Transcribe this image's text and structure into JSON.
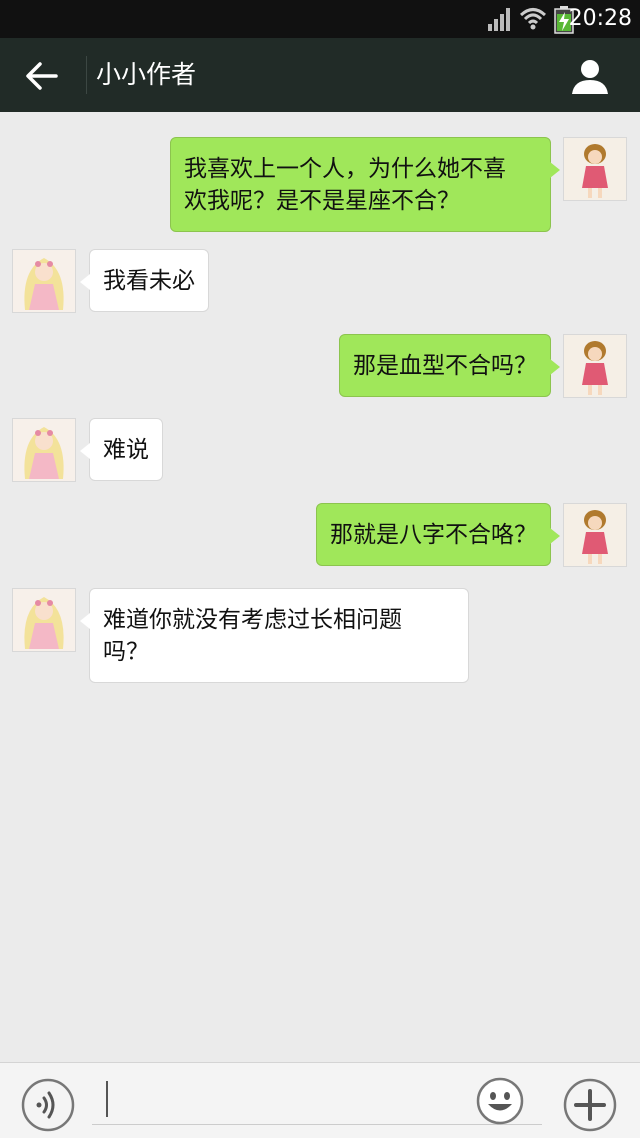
{
  "status_bar": {
    "time": "20:28",
    "icons": [
      "signal-icon",
      "wifi-icon",
      "battery-charging-icon"
    ]
  },
  "header": {
    "title": "小小作者",
    "back_icon": "arrow-left-icon",
    "profile_icon": "person-icon"
  },
  "messages": [
    {
      "sender": "me",
      "text": "我喜欢上一个人，为什么她不喜欢我呢？是不是星座不合？",
      "lines": [
        "我喜欢上一个人，为什么她不喜",
        "欢我呢？是不是星座不合？"
      ]
    },
    {
      "sender": "other",
      "text": "我看未必",
      "lines": [
        "我看未必"
      ]
    },
    {
      "sender": "me",
      "text": "那是血型不合吗？",
      "lines": [
        "那是血型不合吗？"
      ]
    },
    {
      "sender": "other",
      "text": "难说",
      "lines": [
        "难说"
      ]
    },
    {
      "sender": "me",
      "text": "那就是八字不合咯？",
      "lines": [
        "那就是八字不合咯？"
      ]
    },
    {
      "sender": "other",
      "text": "难道你就没有考虑过长相问题吗？",
      "lines": [
        "难道你就没有考虑过长相问题",
        "吗？"
      ]
    }
  ],
  "input_bar": {
    "input_value": "",
    "voice_icon": "voice-icon",
    "emoji_icon": "smiley-icon",
    "plus_icon": "plus-icon"
  },
  "colors": {
    "header_bg": "#212b27",
    "my_bubble": "#a0e75a",
    "other_bubble": "#ffffff",
    "chat_bg": "#ebebeb"
  }
}
